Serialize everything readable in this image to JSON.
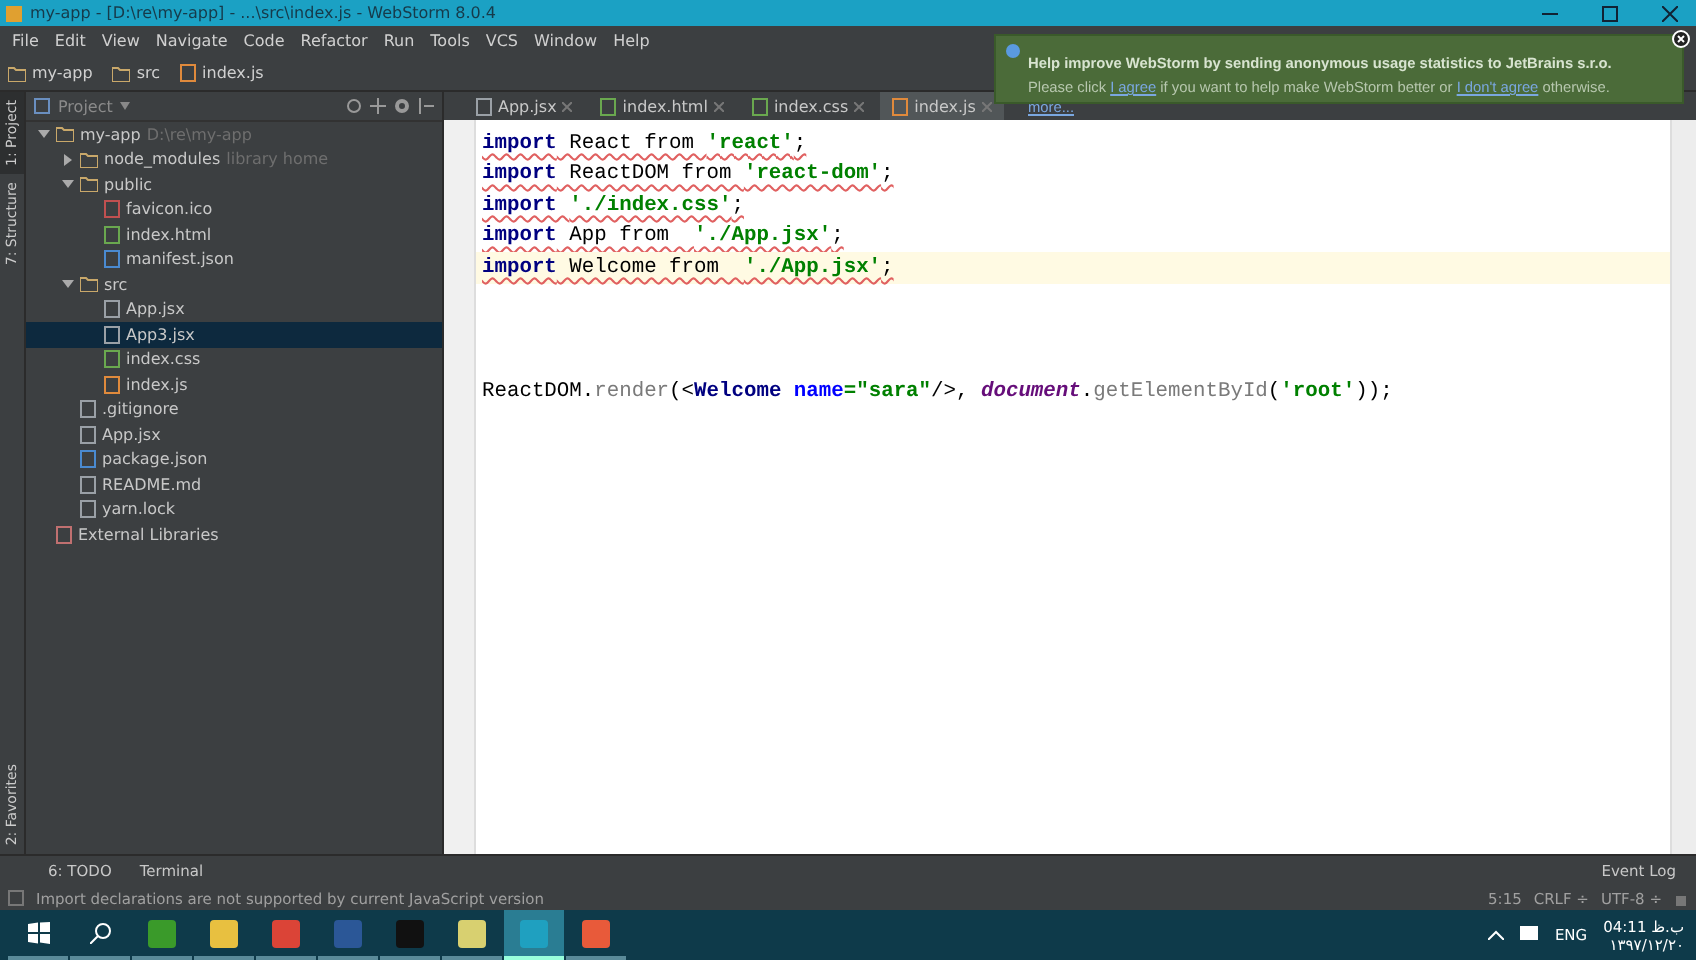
{
  "window": {
    "title": "my-app - [D:\\re\\my-app] - ...\\src\\index.js - WebStorm 8.0.4"
  },
  "menu": [
    "File",
    "Edit",
    "View",
    "Navigate",
    "Code",
    "Refactor",
    "Run",
    "Tools",
    "VCS",
    "Window",
    "Help"
  ],
  "breadcrumbs": [
    {
      "label": "my-app",
      "kind": "folder"
    },
    {
      "label": "src",
      "kind": "folder"
    },
    {
      "label": "index.js",
      "kind": "js"
    }
  ],
  "side_strip": {
    "top": [
      {
        "label": "1: Project",
        "selected": true
      },
      {
        "label": "7: Structure",
        "selected": false
      }
    ],
    "bottom": [
      {
        "label": "2: Favorites",
        "selected": false
      }
    ]
  },
  "project_panel": {
    "title": "Project",
    "tree": [
      {
        "label": "my-app",
        "hint": "D:\\re\\my-app",
        "kind": "folder",
        "expanded": true,
        "selected": false,
        "children": [
          {
            "label": "node_modules",
            "hint": "library home",
            "kind": "folder",
            "expanded": false,
            "selected": false
          },
          {
            "label": "public",
            "kind": "folder",
            "expanded": true,
            "selected": false,
            "children": [
              {
                "label": "favicon.ico",
                "kind": "image",
                "selected": false
              },
              {
                "label": "index.html",
                "kind": "html",
                "selected": false
              },
              {
                "label": "manifest.json",
                "kind": "json",
                "selected": false
              }
            ]
          },
          {
            "label": "src",
            "kind": "folder",
            "expanded": true,
            "selected": false,
            "children": [
              {
                "label": "App.jsx",
                "kind": "file",
                "selected": false
              },
              {
                "label": "App3.jsx",
                "kind": "file",
                "selected": true
              },
              {
                "label": "index.css",
                "kind": "css",
                "selected": false
              },
              {
                "label": "index.js",
                "kind": "js",
                "selected": false
              }
            ]
          },
          {
            "label": ".gitignore",
            "kind": "file",
            "selected": false
          },
          {
            "label": "App.jsx",
            "kind": "file",
            "selected": false
          },
          {
            "label": "package.json",
            "kind": "json",
            "selected": false
          },
          {
            "label": "README.md",
            "kind": "file",
            "selected": false
          },
          {
            "label": "yarn.lock",
            "kind": "file",
            "selected": false
          }
        ]
      },
      {
        "label": "External Libraries",
        "kind": "library",
        "selected": false
      }
    ]
  },
  "editor_tabs": [
    {
      "label": "App.jsx",
      "kind": "file",
      "selected": false
    },
    {
      "label": "index.html",
      "kind": "html",
      "selected": false
    },
    {
      "label": "index.css",
      "kind": "css",
      "selected": false
    },
    {
      "label": "index.js",
      "kind": "js",
      "selected": true
    }
  ],
  "code_lines": [
    {
      "kind": "code",
      "current": false,
      "error": true,
      "tokens": [
        {
          "kind": "keyword",
          "text": "import"
        },
        {
          "kind": "plain",
          "text": " React from "
        },
        {
          "kind": "string",
          "text": "'react'"
        },
        {
          "kind": "plain",
          "text": ";"
        }
      ]
    },
    {
      "kind": "code",
      "current": false,
      "error": true,
      "tokens": [
        {
          "kind": "keyword",
          "text": "import"
        },
        {
          "kind": "plain",
          "text": " ReactDOM from "
        },
        {
          "kind": "string",
          "text": "'react-dom'"
        },
        {
          "kind": "plain",
          "text": ";"
        }
      ]
    },
    {
      "kind": "code",
      "current": false,
      "error": true,
      "tokens": [
        {
          "kind": "keyword",
          "text": "import "
        },
        {
          "kind": "string",
          "text": "'./index.css'"
        },
        {
          "kind": "plain",
          "text": ";"
        }
      ]
    },
    {
      "kind": "code",
      "current": false,
      "error": true,
      "tokens": [
        {
          "kind": "keyword",
          "text": "import"
        },
        {
          "kind": "plain",
          "text": " App from  "
        },
        {
          "kind": "string",
          "text": "'./App.jsx'"
        },
        {
          "kind": "plain",
          "text": ";"
        }
      ]
    },
    {
      "kind": "code",
      "current": true,
      "error": true,
      "tokens": [
        {
          "kind": "keyword",
          "text": "import"
        },
        {
          "kind": "plain",
          "text": " Welcome from  "
        },
        {
          "kind": "string",
          "text": "'./App.jsx'"
        },
        {
          "kind": "plain",
          "text": ";"
        }
      ]
    },
    {
      "kind": "blank"
    },
    {
      "kind": "blank"
    },
    {
      "kind": "blank"
    },
    {
      "kind": "code",
      "current": false,
      "error": false,
      "tokens": [
        {
          "kind": "plain",
          "text": "ReactDOM."
        },
        {
          "kind": "method",
          "text": "render"
        },
        {
          "kind": "plain",
          "text": "(<"
        },
        {
          "kind": "tag",
          "text": "Welcome "
        },
        {
          "kind": "attr",
          "text": "name"
        },
        {
          "kind": "string",
          "text": "=\"sara\""
        },
        {
          "kind": "plain",
          "text": "/>, "
        },
        {
          "kind": "global",
          "text": "document"
        },
        {
          "kind": "plain",
          "text": "."
        },
        {
          "kind": "method",
          "text": "getElementById"
        },
        {
          "kind": "plain",
          "text": "("
        },
        {
          "kind": "string",
          "text": "'root'"
        },
        {
          "kind": "plain",
          "text": "));"
        }
      ]
    }
  ],
  "notification": {
    "title": "Help improve WebStorm by sending anonymous usage statistics to JetBrains s.r.o.",
    "message": [
      {
        "kind": "text",
        "text": "Please click "
      },
      {
        "kind": "link",
        "text": "I agree"
      },
      {
        "kind": "text",
        "text": " if you want to help make WebStorm better or "
      },
      {
        "kind": "link",
        "text": "I don't agree"
      },
      {
        "kind": "text",
        "text": " otherwise."
      }
    ],
    "more": "more..."
  },
  "tool_windows": [
    {
      "label": "6: TODO"
    },
    {
      "label": "Terminal"
    }
  ],
  "event_log": "Event Log",
  "status_bar": {
    "message": "Import declarations are not supported by current JavaScript version",
    "position": "5:15",
    "line_separator": "CRLF ÷",
    "encoding": "UTF-8 ÷"
  },
  "taskbar": {
    "apps": [
      {
        "kind": "camtasia",
        "selected": false
      },
      {
        "kind": "explorer",
        "selected": false
      },
      {
        "kind": "chrome",
        "selected": false
      },
      {
        "kind": "word",
        "selected": false
      },
      {
        "kind": "terminal",
        "selected": false
      },
      {
        "kind": "photos",
        "selected": false
      },
      {
        "kind": "webstorm",
        "selected": true
      },
      {
        "kind": "recorder",
        "selected": false
      }
    ],
    "language": "ENG",
    "time": "ب.ظ 04:11",
    "date": "۱۳۹۷/۱۲/۲۰"
  }
}
